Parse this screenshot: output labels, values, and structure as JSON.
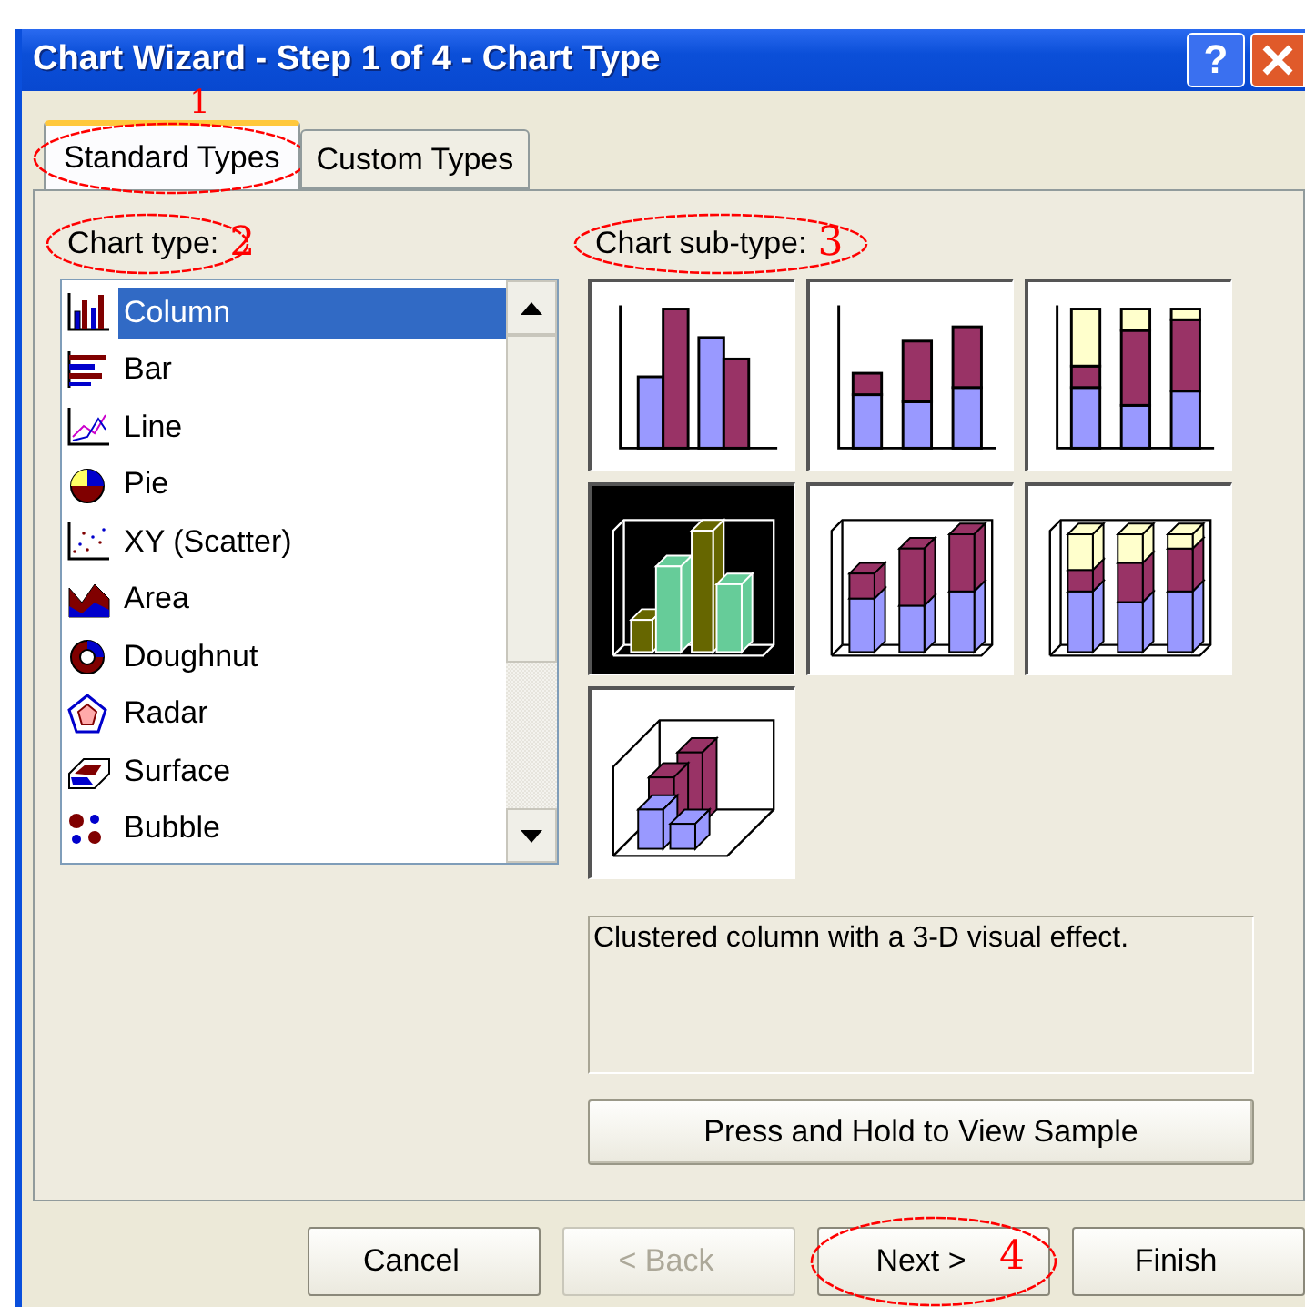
{
  "window": {
    "title": "Chart Wizard - Step 1 of 4 - Chart Type",
    "help_button": "?"
  },
  "tabs": [
    {
      "label": "Standard Types",
      "selected": true,
      "annotation": "1"
    },
    {
      "label": "Custom Types",
      "selected": false
    }
  ],
  "chart_type": {
    "label": "Chart type:",
    "annotation": "2",
    "items": [
      {
        "label": "Column",
        "selected": true
      },
      {
        "label": "Bar",
        "selected": false
      },
      {
        "label": "Line",
        "selected": false
      },
      {
        "label": "Pie",
        "selected": false
      },
      {
        "label": "XY (Scatter)",
        "selected": false
      },
      {
        "label": "Area",
        "selected": false
      },
      {
        "label": "Doughnut",
        "selected": false
      },
      {
        "label": "Radar",
        "selected": false
      },
      {
        "label": "Surface",
        "selected": false
      },
      {
        "label": "Bubble",
        "selected": false
      }
    ]
  },
  "chart_subtype": {
    "label": "Chart sub-type:",
    "annotation": "3",
    "tiles": [
      {
        "selected": false
      },
      {
        "selected": false
      },
      {
        "selected": false
      },
      {
        "selected": true
      },
      {
        "selected": false
      },
      {
        "selected": false
      },
      {
        "selected": false
      }
    ]
  },
  "description": "Clustered column with a 3-D visual effect.",
  "sample_button": "Press and Hold to View Sample",
  "buttons": [
    {
      "label": "Cancel",
      "disabled": false
    },
    {
      "label": "< Back",
      "disabled": true
    },
    {
      "label": "Next >",
      "disabled": false,
      "annotation": "4"
    },
    {
      "label": "Finish",
      "disabled": false
    }
  ]
}
